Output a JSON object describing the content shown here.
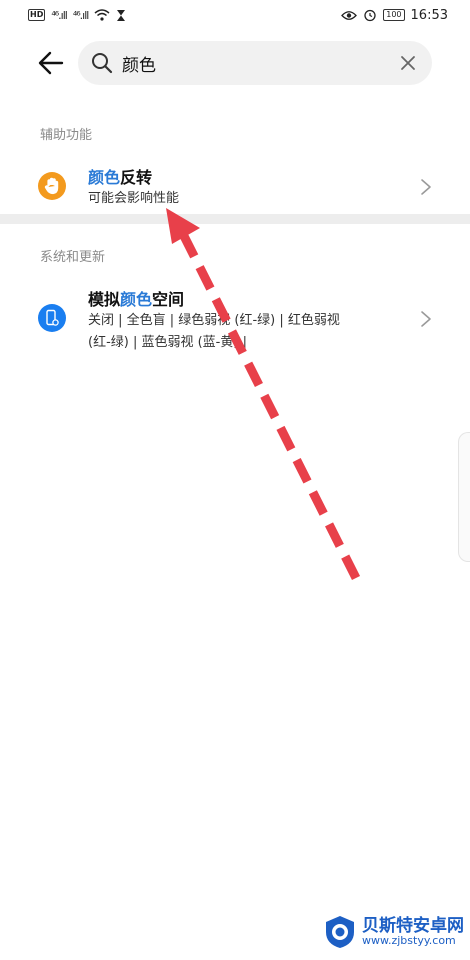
{
  "status_bar": {
    "hd": "HD",
    "signal1": "⁴⁶.ıll",
    "signal2": "⁴⁶.ıll",
    "battery": "100",
    "time": "16:53"
  },
  "search": {
    "value": "颜色",
    "placeholder": ""
  },
  "sections": [
    {
      "header": "辅助功能",
      "results": [
        {
          "title_highlight": "颜色",
          "title_rest": "反转",
          "subtitle": "可能会影响性能",
          "icon": "hand-icon",
          "icon_color": "#f39a1e"
        }
      ]
    },
    {
      "header": "系统和更新",
      "results": [
        {
          "title_prefix": "模拟",
          "title_highlight": "颜色",
          "title_rest": "空间",
          "subtitle_line1": "关闭 | 全色盲 | 绿色弱视 (红-绿) | 红色弱视",
          "subtitle_line2": "(红-绿) | 蓝色弱视 (蓝-黄) |",
          "icon": "phone-settings-icon",
          "icon_color": "#1a7ef0"
        }
      ]
    }
  ],
  "watermark": {
    "title": "贝斯特安卓网",
    "url": "www.zjbstyy.com"
  },
  "colors": {
    "accent": "#2a7ad6",
    "arrow": "#e8404a"
  }
}
